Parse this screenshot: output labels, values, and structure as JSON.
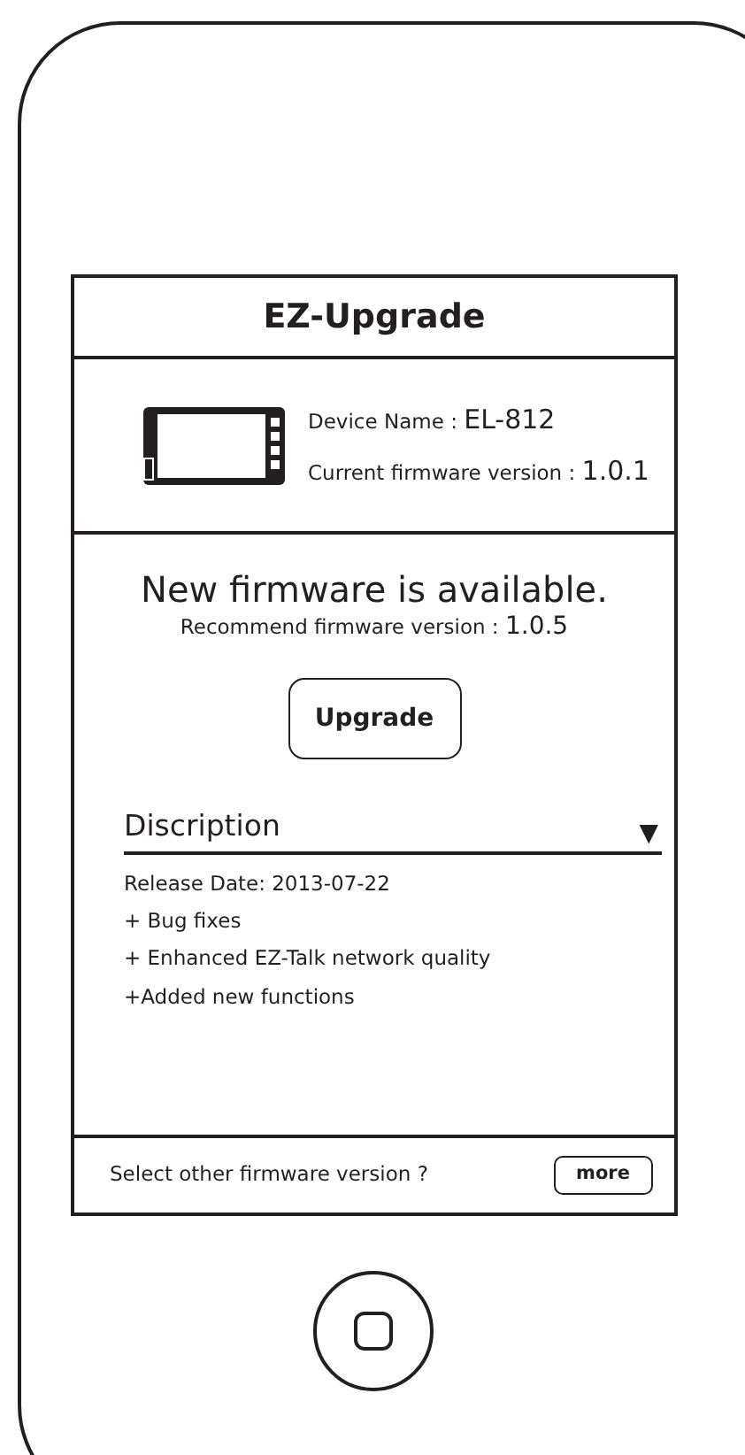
{
  "app": {
    "title": "EZ-Upgrade"
  },
  "device": {
    "name_label": "Device Name :",
    "name": "EL-812",
    "firmware_label": "Current firmware version :",
    "firmware": "1.0.1"
  },
  "update": {
    "headline": "New firmware is available.",
    "recommend_label": "Recommend firmware version :",
    "recommend": "1.0.5",
    "button": "Upgrade"
  },
  "description": {
    "title": "Discription",
    "toggle": "▼",
    "expanded": true,
    "lines": [
      "Release Date: 2013-07-22",
      "+ Bug fixes",
      "+ Enhanced EZ-Talk network quality",
      "+Added new functions"
    ]
  },
  "footer": {
    "text": "Select other firmware version ?",
    "button": "more"
  }
}
